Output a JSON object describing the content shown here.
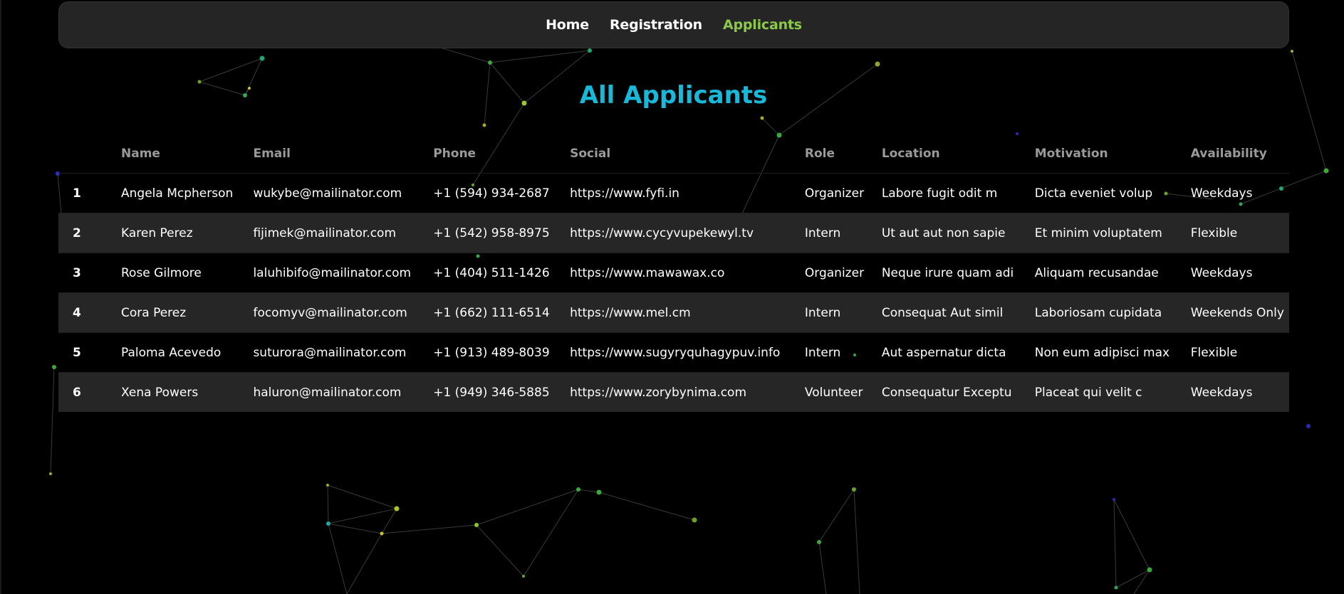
{
  "nav": {
    "items": [
      {
        "label": "Home",
        "active": false
      },
      {
        "label": "Registration",
        "active": false
      },
      {
        "label": "Applicants",
        "active": true
      }
    ]
  },
  "title": "All Applicants",
  "table": {
    "headers": {
      "index": "",
      "name": "Name",
      "email": "Email",
      "phone": "Phone",
      "social": "Social",
      "role": "Role",
      "location": "Location",
      "motivation": "Motivation",
      "availability": "Availability"
    },
    "rows": [
      {
        "index": "1",
        "name": "Angela Mcpherson",
        "email": "wukybe@mailinator.com",
        "phone": "+1 (594) 934-2687",
        "social": "https://www.fyfi.in",
        "role": "Organizer",
        "location": "Labore fugit odit m",
        "motivation": "Dicta eveniet volup",
        "availability": "Weekdays"
      },
      {
        "index": "2",
        "name": "Karen Perez",
        "email": "fijimek@mailinator.com",
        "phone": "+1 (542) 958-8975",
        "social": "https://www.cycyvupekewyl.tv",
        "role": "Intern",
        "location": "Ut aut aut non sapie",
        "motivation": "Et minim voluptatem",
        "availability": "Flexible"
      },
      {
        "index": "3",
        "name": "Rose Gilmore",
        "email": "laluhibifo@mailinator.com",
        "phone": "+1 (404) 511-1426",
        "social": "https://www.mawawax.co",
        "role": "Organizer",
        "location": "Neque irure quam adi",
        "motivation": "Aliquam recusandae",
        "availability": "Weekdays"
      },
      {
        "index": "4",
        "name": "Cora Perez",
        "email": "focomyv@mailinator.com",
        "phone": "+1 (662) 111-6514",
        "social": "https://www.mel.cm",
        "role": "Intern",
        "location": "Consequat Aut simil",
        "motivation": "Laboriosam cupidata",
        "availability": "Weekends Only"
      },
      {
        "index": "5",
        "name": "Paloma Acevedo",
        "email": "suturora@mailinator.com",
        "phone": "+1 (913) 489-8039",
        "social": "https://www.sugyryquhagypuv.info",
        "role": "Intern",
        "location": "Aut aspernatur dicta",
        "motivation": "Non eum adipisci max",
        "availability": "Flexible"
      },
      {
        "index": "6",
        "name": "Xena Powers",
        "email": "haluron@mailinator.com",
        "phone": "+1 (949) 346-5885",
        "social": "https://www.zorybynima.com",
        "role": "Volunteer",
        "location": "Consequatur Exceptu",
        "motivation": "Placeat qui velit c",
        "availability": "Weekdays"
      }
    ]
  },
  "colors": {
    "background": "#000000",
    "nav_background": "#252525",
    "accent_green": "#8cc84b",
    "title_cyan": "#1ab8d8",
    "header_gray": "#9a9a9a",
    "alt_row": "#262626"
  },
  "decor": {
    "background_icon": "particle-network"
  }
}
